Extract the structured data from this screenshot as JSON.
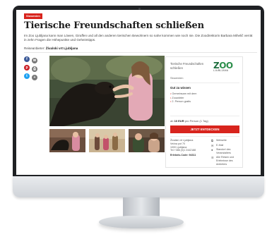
{
  "article": {
    "badge": "Slowenien",
    "title": "Tierische Freundschaften schließen",
    "intro": "Im Zoo Ljubljana kann man Löwen, Giraffen und all den anderen tierischen Bewohnern so nahe kommen wie noch nie. Die Zoodirektorin Barbara Mihelič verrät in zehn Fragen die Höhepunkte und Geheimtipps.",
    "author_label": "Reiseanbieter:",
    "author_name": "Živalski vrt Ljubljana"
  },
  "social": {
    "facebook": "f",
    "mail": "✉",
    "pinterest": "p",
    "print": "⎙",
    "twitter": "t",
    "share": "+"
  },
  "card": {
    "name": "Tierische Freundschaften schließen",
    "logo_word": "ZOO",
    "logo_sub": "LJUBLJANA",
    "country": "Slowenien",
    "heading": "Gut zu wissen",
    "features": [
      "Gemeinsam mit dem",
      "Zoowärter",
      "2. Person gratis"
    ],
    "price_prefix": "ab",
    "price_value": "10 EUR",
    "price_suffix": "pro Person (1 Tag)",
    "cta_label": "JETZT ENTDECKEN",
    "address": [
      "Živalski vrt Ljubljana",
      "Večna pot 70",
      "1000 Ljubljana",
      "Tel.+386 (0)1 2442188"
    ],
    "ident": "Erlebnis-Code: 94311",
    "links": [
      "Webseite",
      "E-Mail",
      "Standort des Veranstalters",
      "Alle Reisen und Erlebnisse des Anbieters"
    ]
  },
  "colors": {
    "brand_red": "#d8241d",
    "zoo_green": "#2d8f4c"
  },
  "icons": {
    "web": "web-icon",
    "mail": "mail-icon",
    "location": "location-pin-icon",
    "list": "list-icon"
  }
}
